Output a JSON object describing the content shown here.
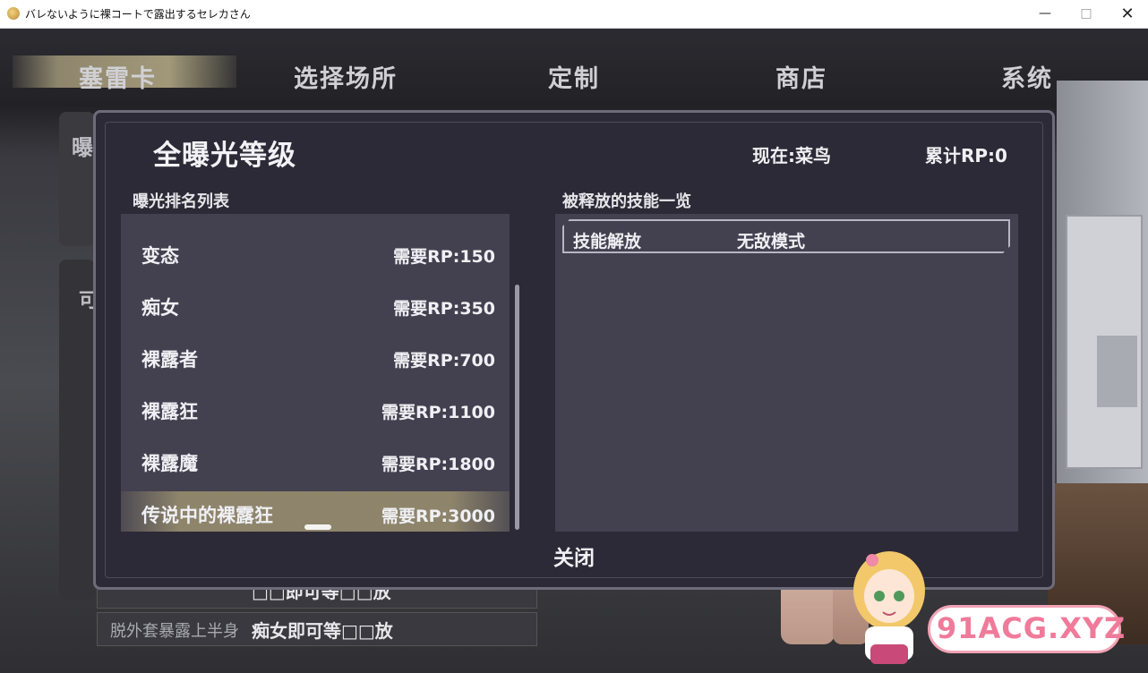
{
  "window": {
    "title": "バレないように裸コートで露出するセレカさん",
    "minimize": "—",
    "maximize": "□",
    "close": "✕"
  },
  "nav": {
    "items": [
      "塞雷卡",
      "选择场所",
      "定制",
      "商店",
      "系统"
    ],
    "active_index": 0
  },
  "background_ui": {
    "left_char_1": "曝",
    "left_char_2": "可",
    "row_1_label": "",
    "row_1_value": "□□即可等□□放",
    "row_2_label": "脱外套暴露上半身",
    "row_2_value": "痴女即可等□□放"
  },
  "dialog": {
    "title": "全曝光等级",
    "current_rank": "现在:菜鸟",
    "total_rp": "累计RP:0",
    "list_title": "曝光排名列表",
    "skills_title": "被释放的技能一览",
    "ranks": [
      {
        "name": "变态",
        "requirement": "需要RP:150"
      },
      {
        "name": "痴女",
        "requirement": "需要RP:350"
      },
      {
        "name": "裸露者",
        "requirement": "需要RP:700"
      },
      {
        "name": "裸露狂",
        "requirement": "需要RP:1100"
      },
      {
        "name": "裸露魔",
        "requirement": "需要RP:1800"
      },
      {
        "name": "传说中的裸露狂",
        "requirement": "需要RP:3000"
      }
    ],
    "selected_rank_index": 5,
    "skills": [
      {
        "name": "技能解放",
        "effect": "无敌模式"
      }
    ],
    "close_label": "关闭"
  },
  "watermark": {
    "text": "91ACG.XYZ"
  },
  "colors": {
    "dialog_bg": "#2c2a36",
    "panel_bg": "#434150",
    "selected_row": "#968c6e",
    "text": "#f0f0f4"
  }
}
